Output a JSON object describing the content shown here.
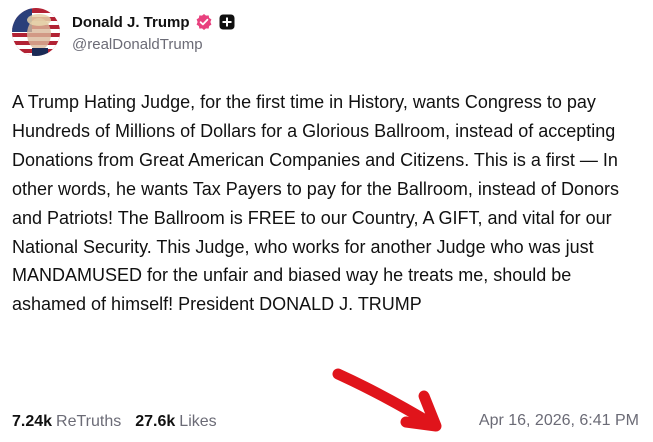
{
  "author": {
    "display_name": "Donald J. Trump",
    "handle": "@realDonaldTrump",
    "avatar_icon": "profile-photo",
    "verified_color": "#e8417e"
  },
  "post": {
    "text": "A Trump Hating Judge, for the first time in History, wants Congress to pay Hundreds of Millions of Dollars for a Glorious Ballroom, instead of accepting Donations from Great American Companies and Citizens. This is a first — In other words, he wants Tax Payers to pay for the Ballroom, instead of Donors and Patriots! The Ballroom is FREE to our Country, A GIFT, and vital for our National Security. This Judge, who works for another Judge who was just MANDAMUSED for the unfair and biased way he treats me, should be ashamed of himself! President DONALD J. TRUMP"
  },
  "stats": {
    "retruths_count": "7.24k",
    "retruths_label": "ReTruths",
    "likes_count": "27.6k",
    "likes_label": "Likes"
  },
  "timestamp": "Apr 16, 2026, 6:41 PM",
  "annotation": {
    "arrow_icon": "red-arrow",
    "color": "#e0141b"
  }
}
